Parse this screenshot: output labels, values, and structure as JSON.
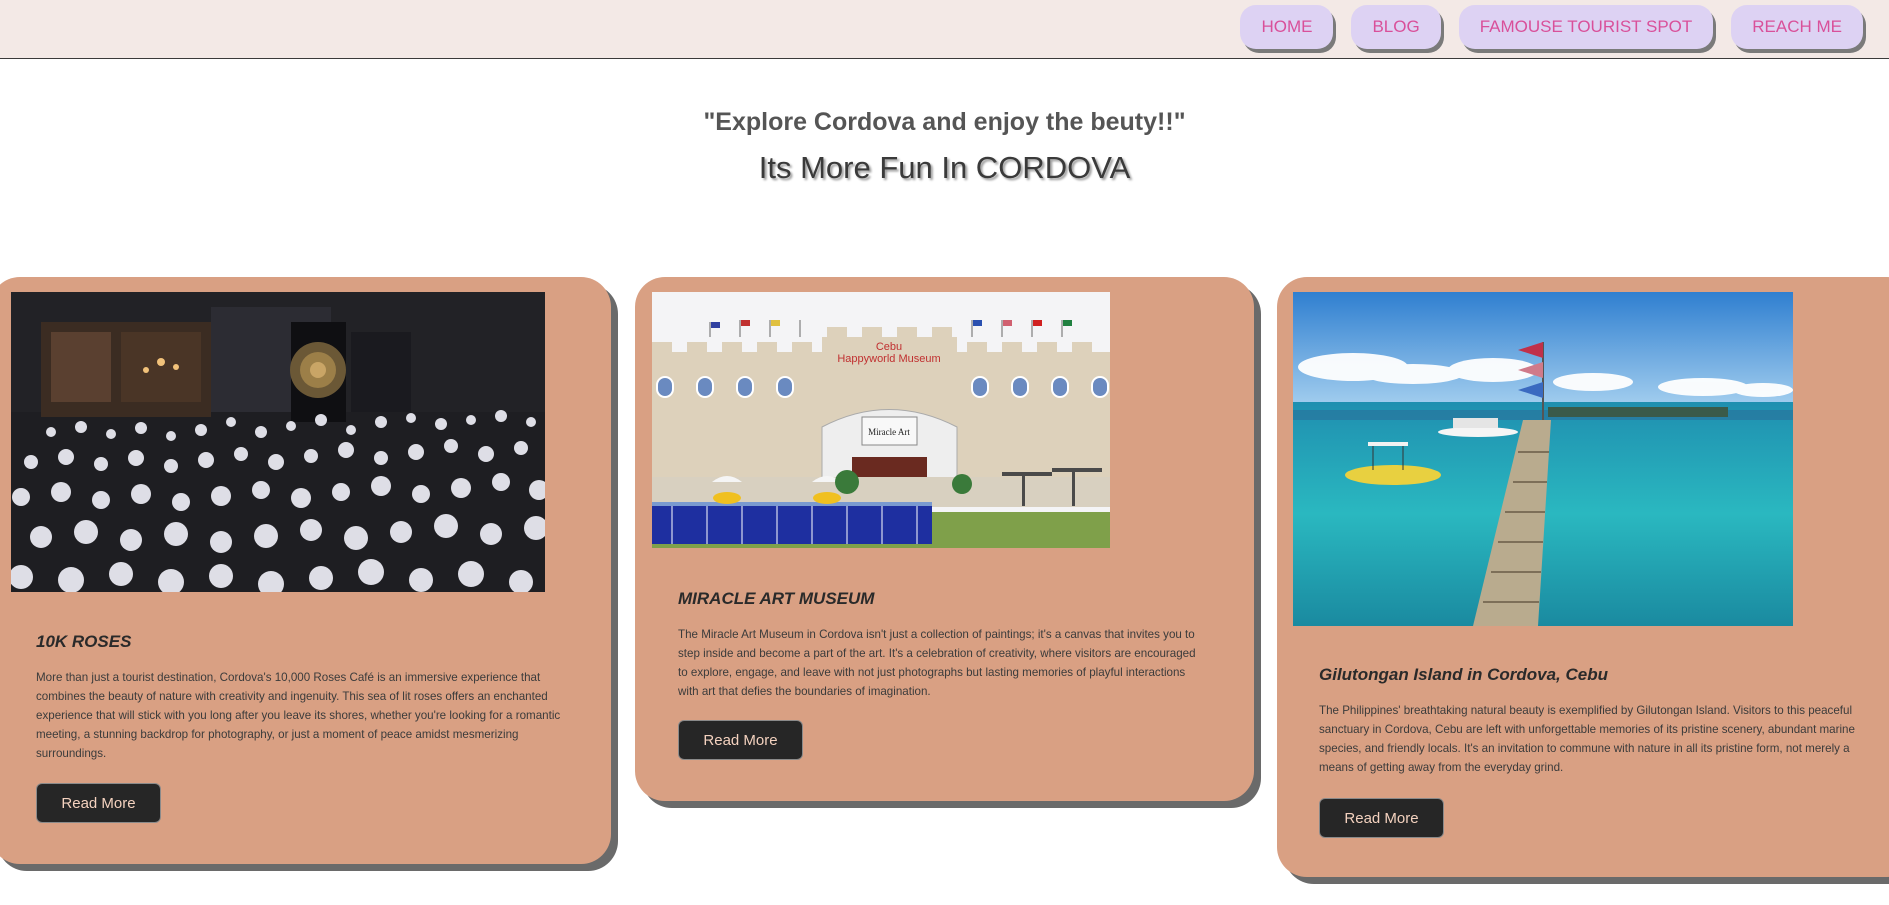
{
  "nav": {
    "items": [
      {
        "label": "HOME"
      },
      {
        "label": "BLOG"
      },
      {
        "label": "FAMOUSE TOURIST SPOT"
      },
      {
        "label": "REACH ME"
      }
    ]
  },
  "hero": {
    "quote": "\"Explore Cordova and enjoy the beuty!!\"",
    "tagline": "Its More Fun In CORDOVA"
  },
  "cards": [
    {
      "title": "10K ROSES",
      "description": "More than just a tourist destination, Cordova's 10,000 Roses Café is an immersive experience that combines the beauty of nature with creativity and ingenuity. This sea of lit roses offers an enchanted experience that will stick with you long after you leave its shores, whether you're looking for a romantic meeting, a stunning backdrop for photography, or just a moment of peace amidst mesmerizing surroundings.",
      "button": "Read More",
      "image_text": ""
    },
    {
      "title": "MIRACLE ART MUSEUM",
      "description": "The Miracle Art Museum in Cordova isn't just a collection of paintings; it's a canvas that invites you to step inside and become a part of the art. It's a celebration of creativity, where visitors are encouraged to explore, engage, and leave with not just photographs but lasting memories of playful interactions with art that defies the boundaries of imagination.",
      "button": "Read More",
      "image_text": "Cebu Happyworld Museum",
      "image_sign": "Miracle Art"
    },
    {
      "title": "Gilutongan Island in Cordova, Cebu",
      "description": "The Philippines' breathtaking natural beauty is exemplified by Gilutongan Island. Visitors to this peaceful sanctuary in Cordova, Cebu are left with unforgettable memories of its pristine scenery, abundant marine species, and friendly locals. It's an invitation to commune with nature in all its pristine form, not merely a means of getting away from the everyday grind.",
      "button": "Read More",
      "image_text": ""
    }
  ],
  "colors": {
    "topbar": "#f3e9e6",
    "nav_button_bg": "#ddd2f3",
    "nav_button_text": "#d9509a",
    "card_bg": "#d9a083",
    "button_bg": "#262626",
    "button_text": "#f4d2bf"
  }
}
